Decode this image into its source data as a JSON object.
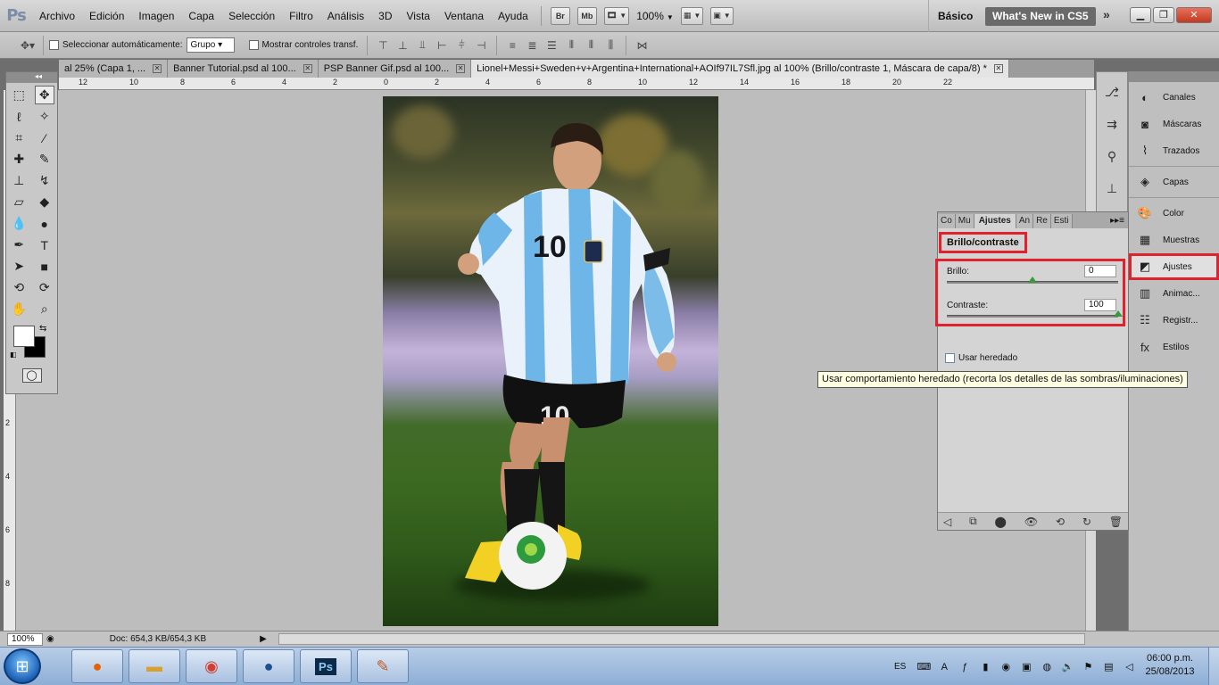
{
  "menubar": {
    "logo": "Ps",
    "items": [
      "Archivo",
      "Edición",
      "Imagen",
      "Capa",
      "Selección",
      "Filtro",
      "Análisis",
      "3D",
      "Vista",
      "Ventana",
      "Ayuda"
    ],
    "bridge": "Br",
    "minibridge": "Mb",
    "zoom": "100%",
    "workspace": "Básico",
    "whats_new": "What's New in CS5",
    "more": "»"
  },
  "optbar": {
    "auto_select_label": "Seleccionar automáticamente:",
    "auto_select_value": "Grupo",
    "transform_label": "Mostrar controles transf."
  },
  "tabs": [
    {
      "label": "al 25% (Capa 1, ...",
      "close": "✕"
    },
    {
      "label": "Banner Tutorial.psd al 100...",
      "close": "✕"
    },
    {
      "label": "PSP Banner Gif.psd al 100...",
      "close": "✕"
    },
    {
      "label": "Lionel+Messi+Sweden+v+Argentina+International+AOIf97IL7Sfl.jpg al 100% (Brillo/contraste 1, Máscara de capa/8) *",
      "close": "✕"
    }
  ],
  "ruler_top": [
    "12",
    "10",
    "8",
    "6",
    "4",
    "2",
    "0",
    "2",
    "4",
    "6",
    "8",
    "10",
    "12",
    "14",
    "16",
    "18",
    "20",
    "22"
  ],
  "ruler_left": [
    "0",
    "2",
    "4",
    "6",
    "8",
    "0",
    "2",
    "4",
    "6",
    "8",
    "2"
  ],
  "statusbar": {
    "zoom": "100%",
    "doc": "Doc: 654,3 KB/654,3 KB",
    "arrow": "▶"
  },
  "dock": {
    "group1": [
      {
        "label": "Canales",
        "icon": "channels-icon"
      },
      {
        "label": "Máscaras",
        "icon": "masks-icon"
      },
      {
        "label": "Trazados",
        "icon": "paths-icon"
      }
    ],
    "group2": [
      {
        "label": "Capas",
        "icon": "layers-icon"
      }
    ],
    "group3": [
      {
        "label": "Color",
        "icon": "color-icon"
      },
      {
        "label": "Muestras",
        "icon": "swatches-icon"
      },
      {
        "label": "Ajustes",
        "icon": "adjustments-icon"
      },
      {
        "label": "Animac...",
        "icon": "animation-icon"
      },
      {
        "label": "Registr...",
        "icon": "history-icon"
      },
      {
        "label": "Estilos",
        "icon": "styles-icon"
      }
    ]
  },
  "adjustments": {
    "tabs": [
      "Co",
      "Mu",
      "Ajustes",
      "An",
      "Re",
      "Esti"
    ],
    "menu": "▸▸≡",
    "title": "Brillo/contraste",
    "brightness_label": "Brillo:",
    "brightness_value": "0",
    "brightness_fraction": 0.5,
    "contrast_label": "Contraste:",
    "contrast_value": "100",
    "contrast_fraction": 1.0,
    "legacy_label": "Usar heredado"
  },
  "tooltip": "Usar comportamiento heredado (recorta los detalles de las sombras/iluminaciones)",
  "taskbar": {
    "clock_time": "06:00 p.m.",
    "clock_date": "25/08/2013",
    "lang": "ES"
  }
}
